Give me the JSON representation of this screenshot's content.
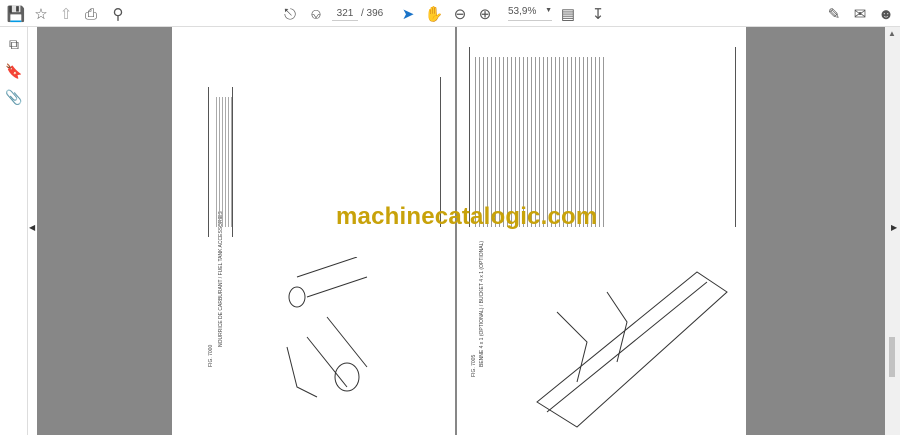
{
  "toolbar": {
    "save_icon": "save-icon",
    "bookmark_icon": "star-icon",
    "upload_icon": "cloud-upload-icon",
    "print_icon": "print-icon",
    "find_icon": "search-icon",
    "current_page": "321",
    "total_pages": "/ 396",
    "zoom_level": "53,9%"
  },
  "watermark": "machinecatalogic.com",
  "pages": {
    "left": {
      "fig": "FIG. 7000",
      "title": "NOURRICE DE CARBURANT / FUEL TANK ACCESSORIES"
    },
    "right": {
      "fig": "FIG. 7005",
      "title": "BENNE 4 x 1 (OPTIONAL) / BUCKET 4 x 1 (OPTIONAL)"
    }
  }
}
